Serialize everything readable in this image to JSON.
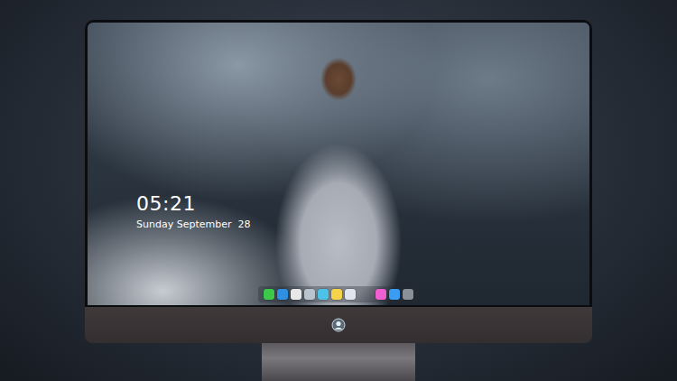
{
  "lock_screen": {
    "time": "05:21",
    "date": "Sunday September  28"
  },
  "wallpaper": {
    "kind": "photo"
  },
  "dock": {
    "items": [
      {
        "color": "#3cc84a"
      },
      {
        "color": "#2f8fe0"
      },
      {
        "color": "#e8e8e8"
      },
      {
        "color": "#b9c4cf"
      },
      {
        "color": "#4cc3e6"
      },
      {
        "color": "#f5d44a"
      },
      {
        "color": "#dfe6ee"
      },
      {
        "color": "#ee5fd0"
      },
      {
        "color": "#3a9cf2"
      },
      {
        "color": "#8a9098"
      }
    ]
  }
}
